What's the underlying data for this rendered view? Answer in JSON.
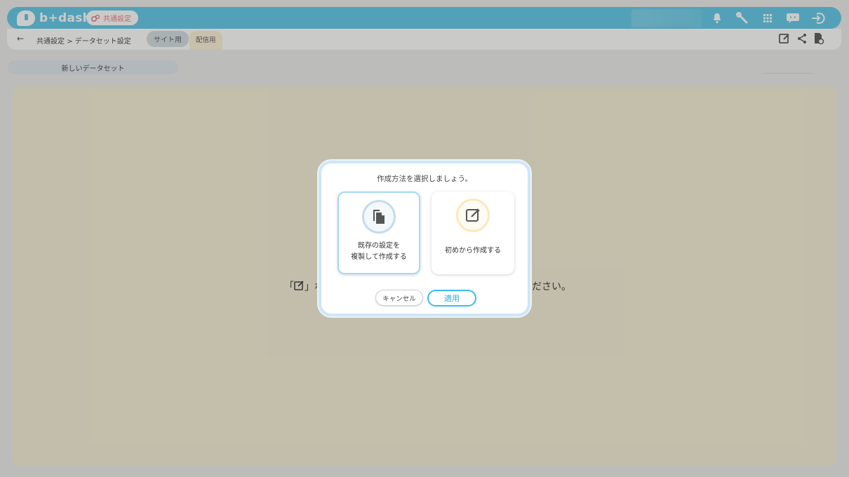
{
  "header": {
    "logo_text": "b+dash",
    "mode_label": "共通設定",
    "icons": [
      "bell-icon",
      "wrench-icon",
      "grid-icon",
      "chat-icon",
      "logout-icon"
    ],
    "accent_color": "#5cc7ea"
  },
  "subbar": {
    "back_arrow": "←",
    "breadcrumb": "共通設定 > データセット設定",
    "tab_site": "サイト用",
    "tab_delivery": "配信用",
    "icons": [
      "edit-icon",
      "share-icon",
      "file-settings-icon"
    ]
  },
  "toolbar": {
    "new_dataset_label": "新しいデータセット"
  },
  "content": {
    "message_prefix": "「",
    "message_icon": "edit-icon",
    "message_visible_left": "」ボ",
    "message_visible_right": "ださい。"
  },
  "modal": {
    "title": "作成方法を選択しましょう。",
    "options": [
      {
        "line1": "既存の設定を",
        "line2": "複製して作成する",
        "icon": "copy-file-icon"
      },
      {
        "line1": "初めから作成する",
        "icon": "edit-icon"
      }
    ],
    "cancel_label": "キャンセル",
    "apply_label": "適用"
  }
}
